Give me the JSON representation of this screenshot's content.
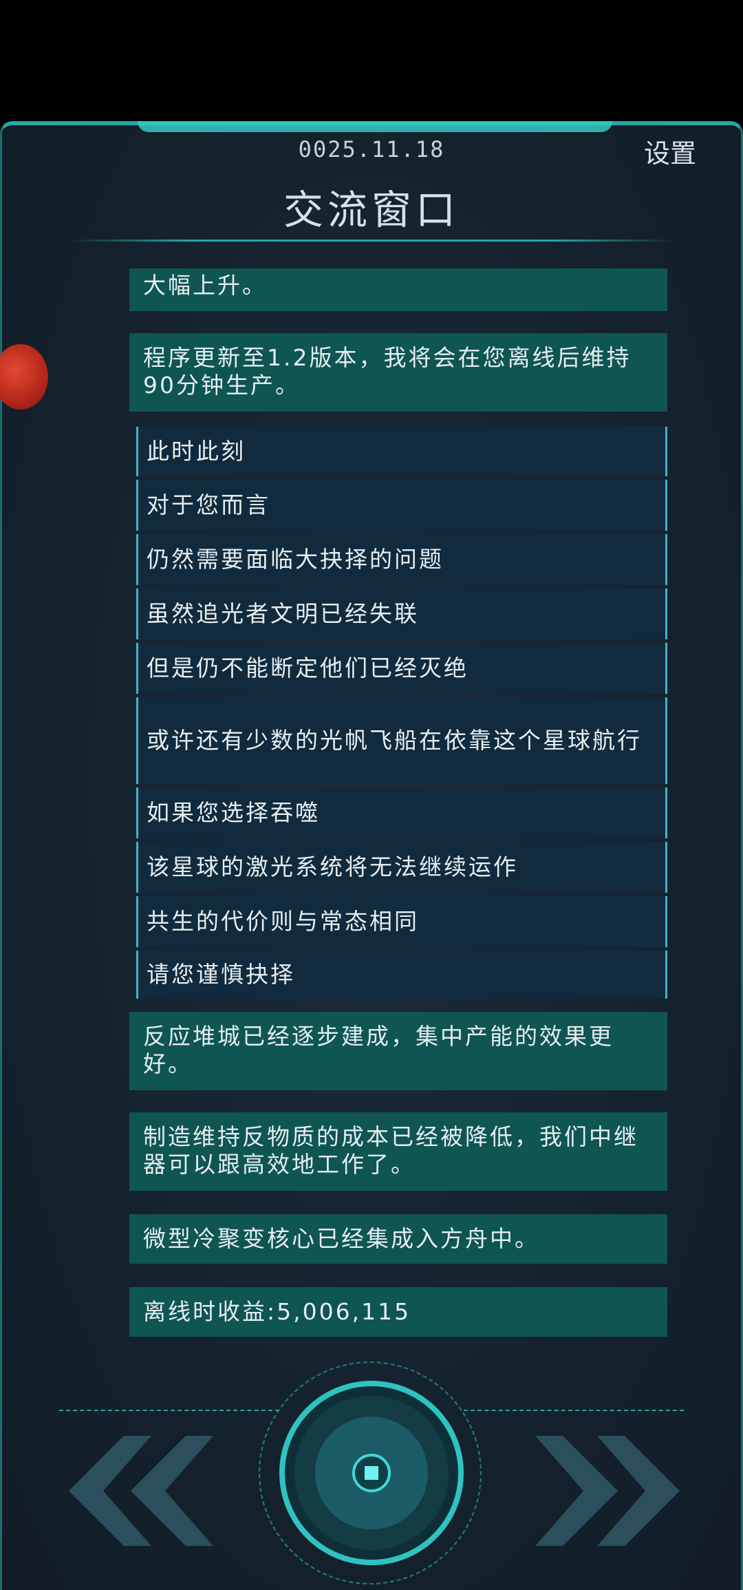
{
  "header": {
    "date": "0025.11.18",
    "settings_label": "设置",
    "title": "交流窗口"
  },
  "messages": [
    {
      "kind": "system",
      "text": "大幅上升。"
    },
    {
      "kind": "system",
      "text": "程序更新至1.2版本，我将会在您离线后维持90分钟生产。"
    },
    {
      "kind": "story",
      "text": "此时此刻"
    },
    {
      "kind": "story",
      "text": "对于您而言"
    },
    {
      "kind": "story",
      "text": "仍然需要面临大抉择的问题"
    },
    {
      "kind": "story",
      "text": "虽然追光者文明已经失联"
    },
    {
      "kind": "story",
      "text": "但是仍不能断定他们已经灭绝"
    },
    {
      "kind": "story",
      "text": "或许还有少数的光帆飞船在依靠这个星球航行"
    },
    {
      "kind": "story",
      "text": "如果您选择吞噬"
    },
    {
      "kind": "story",
      "text": "该星球的激光系统将无法继续运作"
    },
    {
      "kind": "story",
      "text": "共生的代价则与常态相同"
    },
    {
      "kind": "story",
      "text": "请您谨慎抉择"
    },
    {
      "kind": "system",
      "text": "反应堆城已经逐步建成，集中产能的效果更好。"
    },
    {
      "kind": "system",
      "text": "制造维持反物质的成本已经被降低，我们中继器可以跟高效地工作了。"
    },
    {
      "kind": "system",
      "text": "微型冷聚变核心已经集成入方舟中。"
    },
    {
      "kind": "system",
      "text": "离线时收益:5,006,115"
    }
  ],
  "controls": {
    "left_icon": "double-chevron-left-icon",
    "right_icon": "double-chevron-right-icon",
    "center_icon": "circular-core-button-icon"
  },
  "colors": {
    "accent": "#2aa6a2",
    "system_bg": "#0f5552",
    "story_bg": "#112a3d",
    "story_border": "#4ab1c6",
    "planet": "#c8321f"
  }
}
